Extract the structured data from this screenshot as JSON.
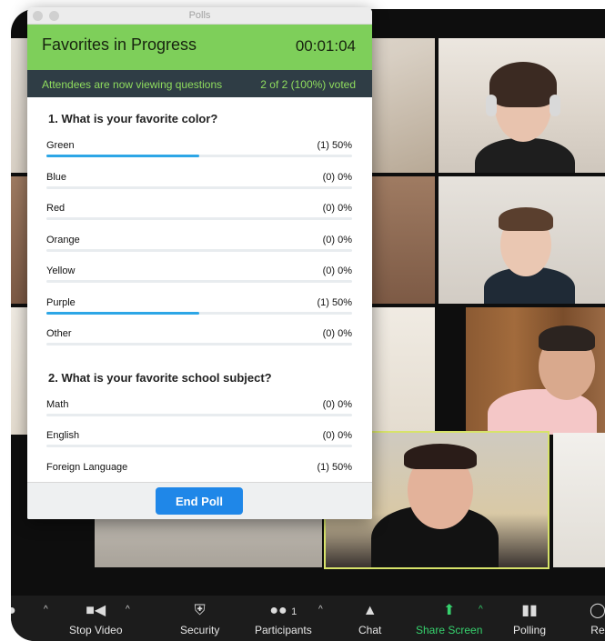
{
  "window": {
    "title": "Polls"
  },
  "poll": {
    "title": "Favorites in Progress",
    "timer": "00:01:04",
    "status": "Attendees are now viewing questions",
    "voted": "2 of 2 (100%) voted",
    "questions": [
      {
        "title": "1. What is your favorite color?",
        "options": [
          {
            "label": "Green",
            "result": "(1) 50%",
            "fraction": 0.5
          },
          {
            "label": "Blue",
            "result": "(0) 0%",
            "fraction": 0
          },
          {
            "label": "Red",
            "result": "(0) 0%",
            "fraction": 0
          },
          {
            "label": "Orange",
            "result": "(0) 0%",
            "fraction": 0
          },
          {
            "label": "Yellow",
            "result": "(0) 0%",
            "fraction": 0
          },
          {
            "label": "Purple",
            "result": "(1) 50%",
            "fraction": 0.5
          },
          {
            "label": "Other",
            "result": "(0) 0%",
            "fraction": 0
          }
        ]
      },
      {
        "title": "2. What is your favorite school subject?",
        "options": [
          {
            "label": "Math",
            "result": "(0) 0%",
            "fraction": 0
          },
          {
            "label": "English",
            "result": "(0) 0%",
            "fraction": 0
          },
          {
            "label": "Foreign Language",
            "result": "(1) 50%",
            "fraction": 0.5
          }
        ]
      }
    ],
    "end_button": "End Poll"
  },
  "toolbar": {
    "items": [
      {
        "label": "e",
        "icon": "microphone-icon"
      },
      {
        "label": "Stop Video",
        "icon": "video-camera-icon"
      },
      {
        "label": "Security",
        "icon": "shield-icon"
      },
      {
        "label": "Participants",
        "icon": "participants-icon",
        "count": "1"
      },
      {
        "label": "Chat",
        "icon": "chat-bubble-icon"
      },
      {
        "label": "Share Screen",
        "icon": "share-screen-icon"
      },
      {
        "label": "Polling",
        "icon": "bar-chart-icon"
      },
      {
        "label": "Re",
        "icon": "record-icon"
      }
    ]
  },
  "colors": {
    "poll_header": "#7ecf5a",
    "poll_subheader": "#2f3d45",
    "bar_fill": "#2da6e6",
    "end_button": "#1f87e8",
    "share_screen": "#36d16d",
    "active_speaker_border": "#d7e36a"
  }
}
